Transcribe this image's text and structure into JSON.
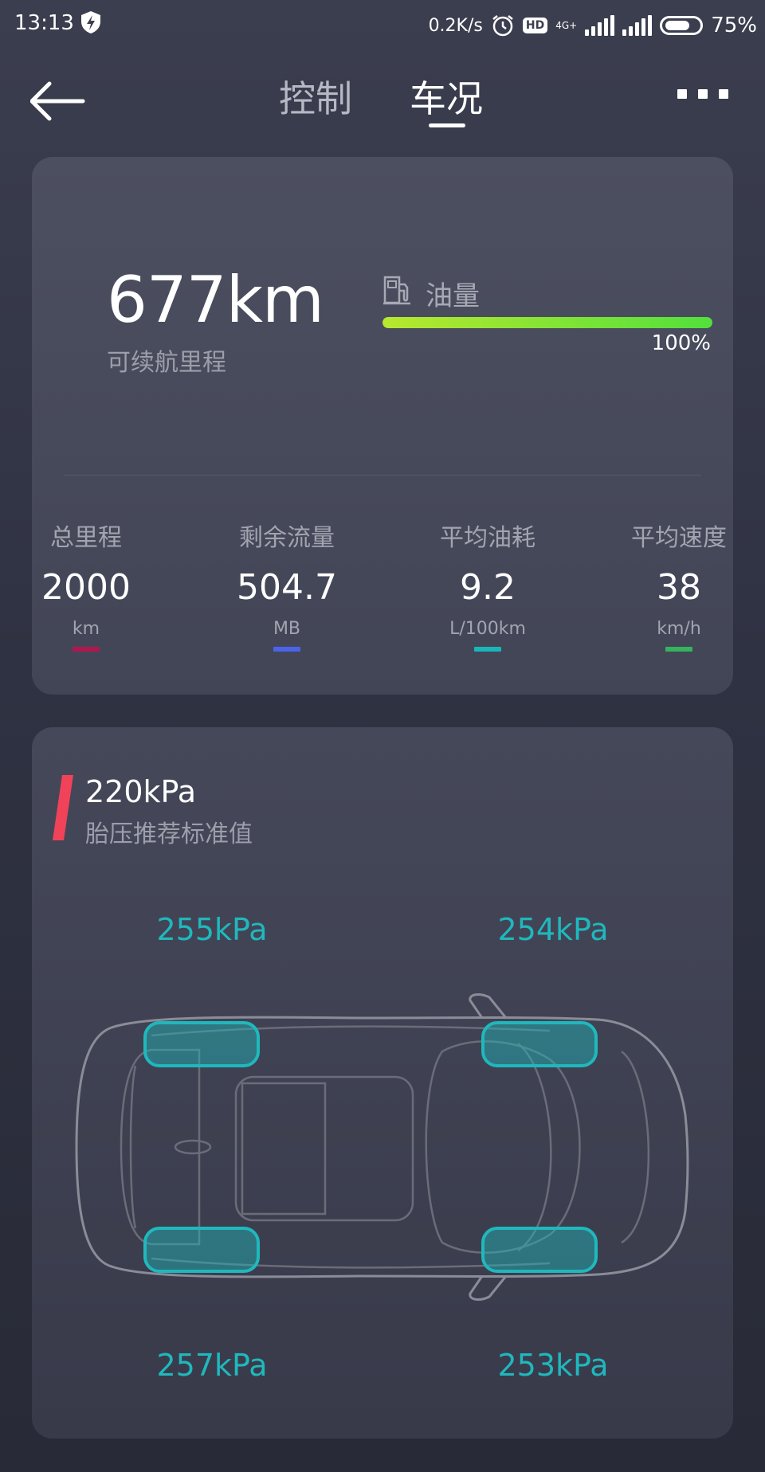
{
  "status_bar": {
    "time": "13:13",
    "net_speed": "0.2K/s",
    "hd": "HD",
    "network": "4G+",
    "battery": "75%",
    "battery_level": 0.75
  },
  "nav": {
    "tabs": [
      "控制",
      "车况"
    ],
    "active_tab": "车况"
  },
  "range": {
    "value": "677km",
    "label": "可续航里程"
  },
  "fuel": {
    "label": "油量",
    "percent_text": "100%",
    "level": 1.0,
    "bar_colors": [
      "#b8e82e",
      "#52e03c"
    ]
  },
  "stats": [
    {
      "label": "总里程",
      "value": "2000",
      "unit": "km",
      "color": "#b0174f"
    },
    {
      "label": "剩余流量",
      "value": "504.7",
      "unit": "MB",
      "color": "#4b63ea"
    },
    {
      "label": "平均油耗",
      "value": "9.2",
      "unit": "L/100km",
      "color": "#19b6b8"
    },
    {
      "label": "平均速度",
      "value": "38",
      "unit": "km/h",
      "color": "#35b35e"
    }
  ],
  "tire_pressure": {
    "recommended_value": "220kPa",
    "recommended_label": "胎压推荐标准值",
    "front_left": "255kPa",
    "front_right": "254kPa",
    "rear_left": "257kPa",
    "rear_right": "253kPa",
    "accent_color": "#1fb8bd"
  }
}
